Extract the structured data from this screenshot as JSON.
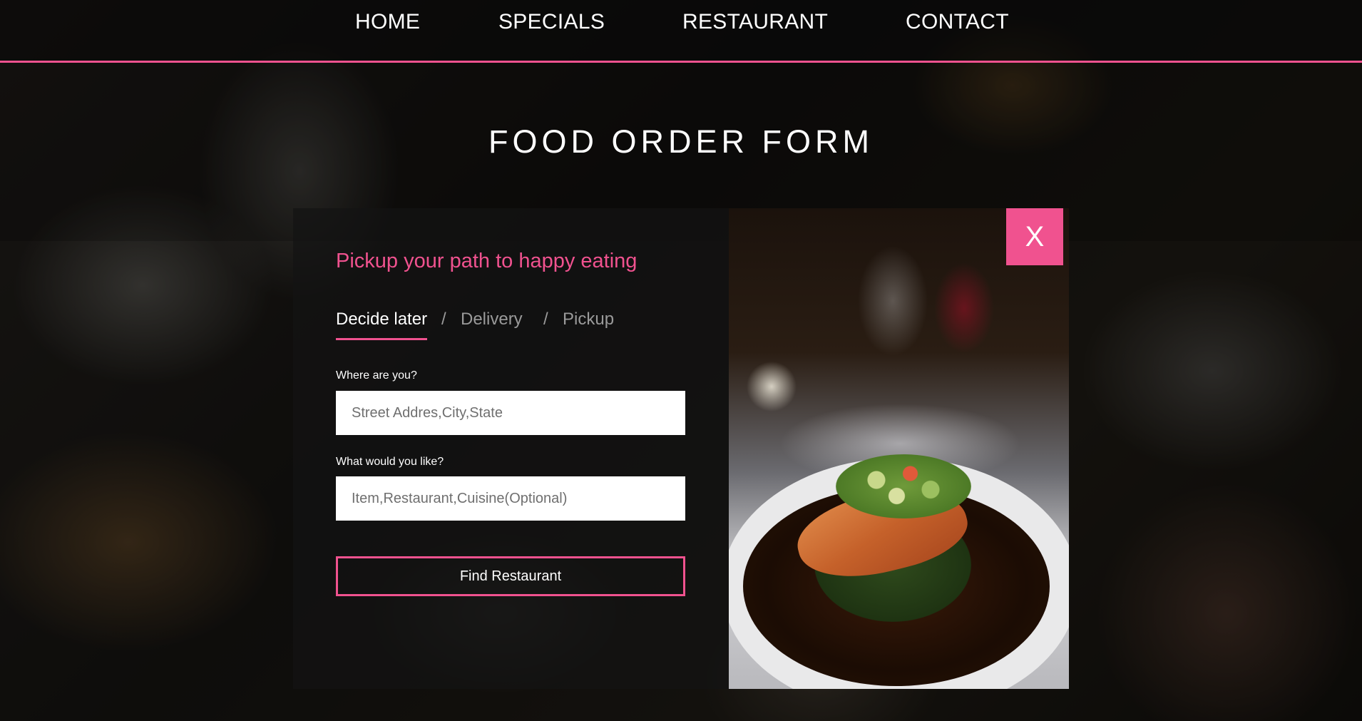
{
  "nav": {
    "items": [
      {
        "label": "HOME"
      },
      {
        "label": "SPECIALS"
      },
      {
        "label": "RESTAURANT"
      },
      {
        "label": "CONTACT"
      }
    ]
  },
  "page": {
    "title": "FOOD ORDER FORM"
  },
  "form": {
    "heading": "Pickup your path to happy eating",
    "tabs": [
      {
        "label": "Decide later",
        "active": true
      },
      {
        "label": "Delivery",
        "active": false
      },
      {
        "label": "Pickup",
        "active": false
      }
    ],
    "separator": "/",
    "location": {
      "label": "Where are you?",
      "value": "",
      "placeholder": "Street Addres,City,State"
    },
    "item": {
      "label": "What would you like?",
      "value": "",
      "placeholder": "Item,Restaurant,Cuisine(Optional)"
    },
    "submit_label": "Find Restaurant"
  },
  "modal": {
    "close_label": "X"
  },
  "colors": {
    "accent": "#f0528f",
    "panel": "#141414"
  }
}
